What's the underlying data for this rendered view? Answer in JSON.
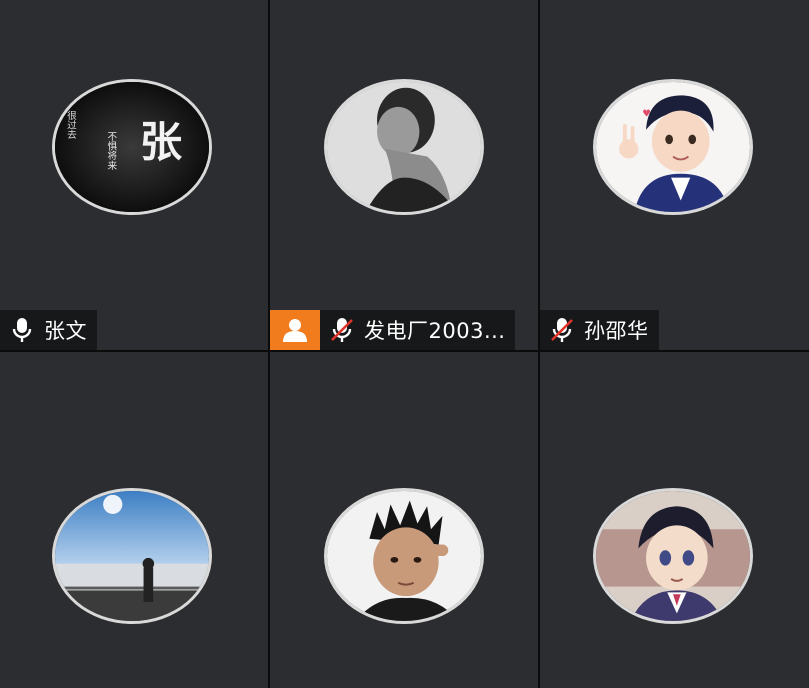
{
  "participants": [
    {
      "name": "张文",
      "mic": "on",
      "host": false,
      "avatar": "calligraphy-avatar",
      "avatar_text": {
        "big": "张",
        "left": "很过去",
        "right": "不惧将来"
      }
    },
    {
      "name": "发电厂2003...",
      "mic": "muted",
      "host": true,
      "avatar": "bw-portrait-avatar"
    },
    {
      "name": "孙邵华",
      "mic": "muted",
      "host": false,
      "avatar": "cartoon-boy-avatar"
    },
    {
      "name": "",
      "mic": "",
      "host": false,
      "avatar": "lakeside-figure-avatar"
    },
    {
      "name": "",
      "mic": "",
      "host": false,
      "avatar": "boy-selfie-avatar"
    },
    {
      "name": "",
      "mic": "",
      "host": false,
      "avatar": "anime-boy-avatar"
    }
  ],
  "icons": {
    "mic_on": "microphone-icon",
    "mic_muted": "microphone-muted-icon",
    "host": "host-person-icon"
  },
  "colors": {
    "tile_bg": "#2c2d30",
    "host_badge": "#f07c1e",
    "muted_slash": "#e2342a"
  }
}
